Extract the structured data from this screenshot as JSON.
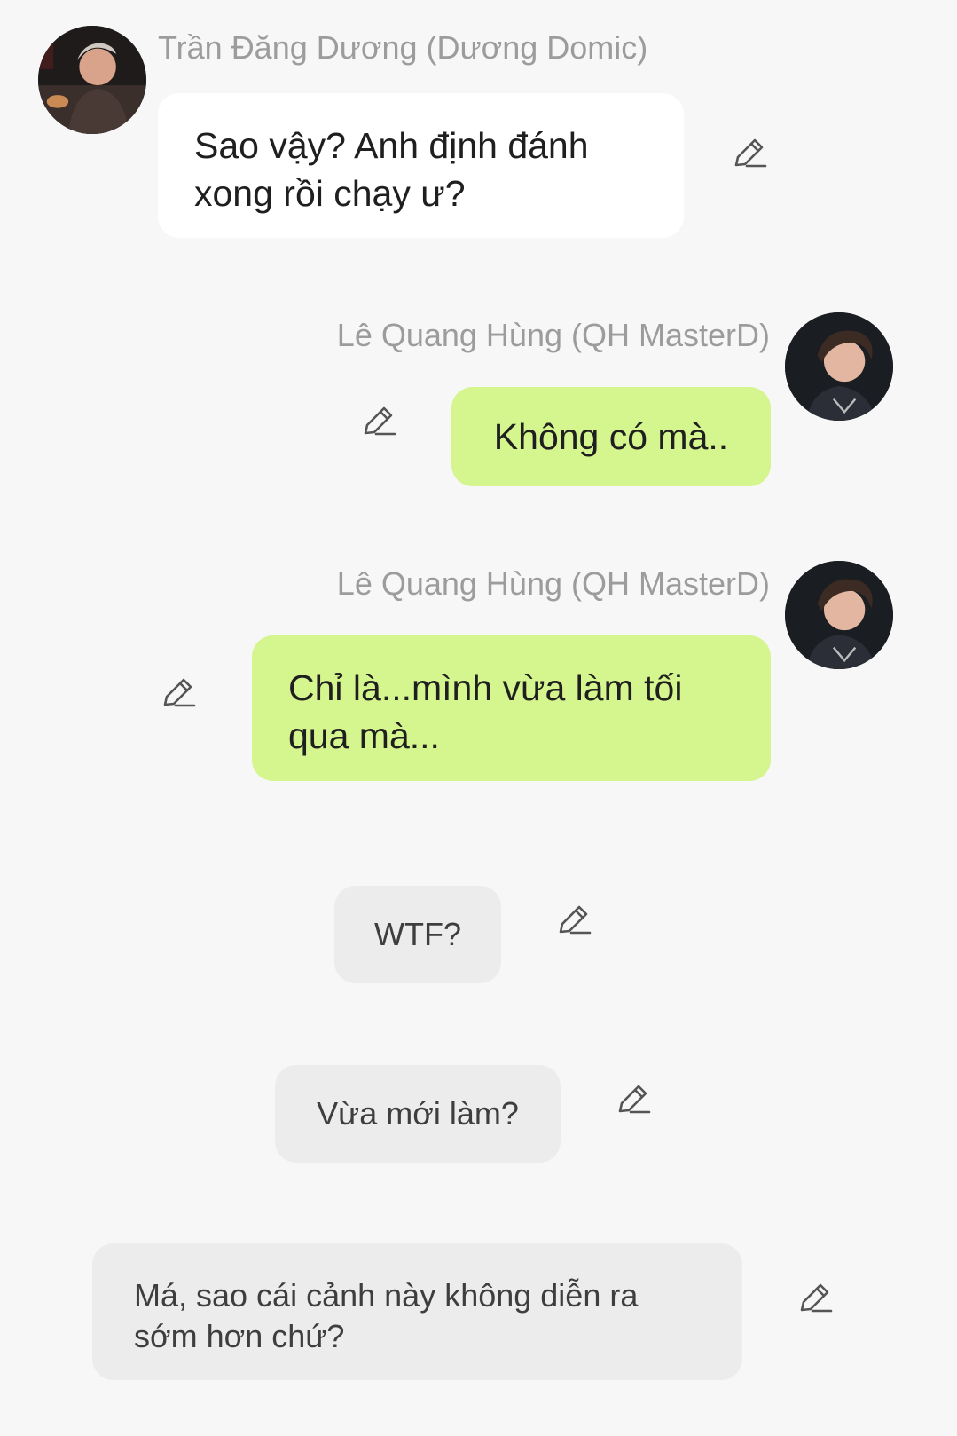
{
  "messages": [
    {
      "sender": "Trần Đăng Dương (Dương Domic)",
      "avatar": "avatar-duong-domic",
      "text": "Sao vậy? Anh định đánh\nxong rồi chạy ư?",
      "edit_icon": "pencil-icon"
    },
    {
      "sender": "Lê Quang Hùng (QH MasterD)",
      "avatar": "avatar-qh-masterd",
      "text": "Không có mà..",
      "edit_icon": "pencil-icon"
    },
    {
      "sender": "Lê Quang Hùng (QH MasterD)",
      "avatar": "avatar-qh-masterd",
      "text": "Chỉ là...mình vừa làm tối\nqua mà...",
      "edit_icon": "pencil-icon"
    },
    {
      "text": "WTF?",
      "edit_icon": "pencil-icon"
    },
    {
      "text": "Vừa mới làm?",
      "edit_icon": "pencil-icon"
    },
    {
      "text": "Má, sao cái cảnh này không diễn ra\nsớm hơn chứ?",
      "edit_icon": "pencil-icon"
    }
  ],
  "colors": {
    "background": "#f7f7f7",
    "incoming_bubble": "#ffffff",
    "outgoing_bubble": "#d5f58e",
    "narration_bubble": "#ececec",
    "sender_name": "#9c9c9c"
  }
}
